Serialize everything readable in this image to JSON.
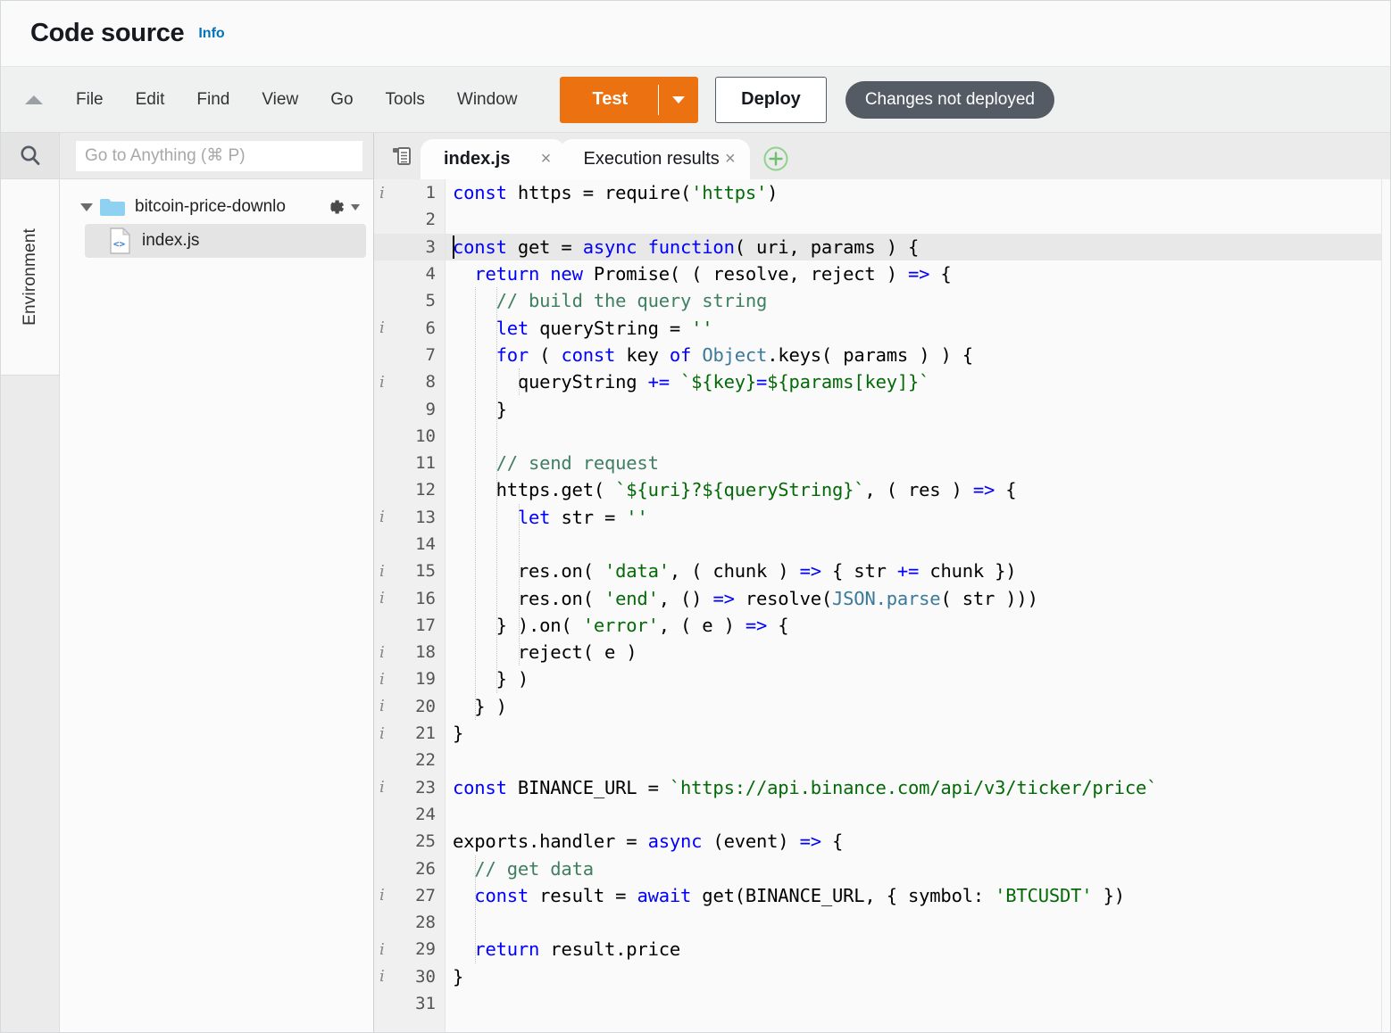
{
  "header": {
    "title": "Code source",
    "info_label": "Info"
  },
  "toolbar": {
    "collapse_icon": "caret-up-icon",
    "menus": [
      "File",
      "Edit",
      "Find",
      "View",
      "Go",
      "Tools",
      "Window"
    ],
    "test_label": "Test",
    "test_caret_icon": "caret-down-icon",
    "deploy_label": "Deploy",
    "status_badge": "Changes not deployed",
    "colors": {
      "test_button": "#ec7211",
      "status_badge": "#545b64",
      "info_link": "#0073bb"
    }
  },
  "rail": {
    "search_icon": "search-icon",
    "environment_label": "Environment"
  },
  "file_tree": {
    "search_placeholder": "Go to Anything (⌘ P)",
    "search_value": "",
    "folder": {
      "name": "bitcoin-price-downlo",
      "expanded": true,
      "caret_icon": "caret-down-icon",
      "folder_icon": "folder-icon",
      "gear_icon": "gear-icon",
      "gear_caret_icon": "caret-down-icon"
    },
    "files": [
      {
        "name": "index.js",
        "icon": "js-file-icon",
        "selected": true
      }
    ]
  },
  "editor": {
    "panel_icon": "document-list-icon",
    "tabs": [
      {
        "label": "index.js",
        "active": true,
        "close_icon": "close-icon"
      },
      {
        "label": "Execution results",
        "active": false,
        "close_icon": "close-icon",
        "clipped": true
      }
    ],
    "add_tab_icon": "plus-circle-icon",
    "cursor_line": 3,
    "info_marker_lines": [
      1,
      6,
      8,
      13,
      15,
      16,
      18,
      19,
      20,
      21,
      23,
      27,
      29,
      30
    ],
    "total_lines_visible": 31,
    "lines": [
      {
        "n": 1,
        "tokens": [
          [
            "kw",
            "const"
          ],
          [
            "txt",
            " https = "
          ],
          [
            "txt",
            "require("
          ],
          [
            "str",
            "'https'"
          ],
          [
            "txt",
            ")"
          ]
        ]
      },
      {
        "n": 2,
        "tokens": []
      },
      {
        "n": 3,
        "tokens": [
          [
            "kw",
            "const"
          ],
          [
            "txt",
            " get = "
          ],
          [
            "kw",
            "async function"
          ],
          [
            "txt",
            "( uri, params ) {"
          ]
        ]
      },
      {
        "n": 4,
        "tokens": [
          [
            "txt",
            "  "
          ],
          [
            "kw",
            "return new"
          ],
          [
            "txt",
            " Promise( ( resolve, reject ) "
          ],
          [
            "op",
            "=>"
          ],
          [
            "txt",
            " {"
          ]
        ]
      },
      {
        "n": 5,
        "tokens": [
          [
            "txt",
            "    "
          ],
          [
            "cmt",
            "// build the query string"
          ]
        ]
      },
      {
        "n": 6,
        "tokens": [
          [
            "txt",
            "    "
          ],
          [
            "kw",
            "let"
          ],
          [
            "txt",
            " queryString = "
          ],
          [
            "str",
            "''"
          ]
        ]
      },
      {
        "n": 7,
        "tokens": [
          [
            "txt",
            "    "
          ],
          [
            "kw",
            "for"
          ],
          [
            "txt",
            " ( "
          ],
          [
            "kw",
            "const"
          ],
          [
            "txt",
            " key "
          ],
          [
            "kw",
            "of"
          ],
          [
            "txt",
            " "
          ],
          [
            "fn",
            "Object"
          ],
          [
            "txt",
            ".keys( params ) ) {"
          ]
        ]
      },
      {
        "n": 8,
        "tokens": [
          [
            "txt",
            "      queryString "
          ],
          [
            "op",
            "+="
          ],
          [
            "txt",
            " "
          ],
          [
            "str",
            "`${key}"
          ],
          [
            "op",
            "="
          ],
          [
            "str",
            "${params[key]}`"
          ]
        ]
      },
      {
        "n": 9,
        "tokens": [
          [
            "txt",
            "    }"
          ]
        ]
      },
      {
        "n": 10,
        "tokens": []
      },
      {
        "n": 11,
        "tokens": [
          [
            "txt",
            "    "
          ],
          [
            "cmt",
            "// send request"
          ]
        ]
      },
      {
        "n": 12,
        "tokens": [
          [
            "txt",
            "    https.get( "
          ],
          [
            "str",
            "`${uri}?${queryString}`"
          ],
          [
            "txt",
            ", ( res ) "
          ],
          [
            "op",
            "=>"
          ],
          [
            "txt",
            " {"
          ]
        ]
      },
      {
        "n": 13,
        "tokens": [
          [
            "txt",
            "      "
          ],
          [
            "kw",
            "let"
          ],
          [
            "txt",
            " str = "
          ],
          [
            "str",
            "''"
          ]
        ]
      },
      {
        "n": 14,
        "tokens": []
      },
      {
        "n": 15,
        "tokens": [
          [
            "txt",
            "      res.on( "
          ],
          [
            "str",
            "'data'"
          ],
          [
            "txt",
            ", ( chunk ) "
          ],
          [
            "op",
            "=>"
          ],
          [
            "txt",
            " { str "
          ],
          [
            "op",
            "+="
          ],
          [
            "txt",
            " chunk })"
          ]
        ]
      },
      {
        "n": 16,
        "tokens": [
          [
            "txt",
            "      res.on( "
          ],
          [
            "str",
            "'end'"
          ],
          [
            "txt",
            ", () "
          ],
          [
            "op",
            "=>"
          ],
          [
            "txt",
            " resolve("
          ],
          [
            "fn",
            "JSON.parse"
          ],
          [
            "txt",
            "( str )))"
          ]
        ]
      },
      {
        "n": 17,
        "tokens": [
          [
            "txt",
            "    } ).on( "
          ],
          [
            "str",
            "'error'"
          ],
          [
            "txt",
            ", ( e ) "
          ],
          [
            "op",
            "=>"
          ],
          [
            "txt",
            " {"
          ]
        ]
      },
      {
        "n": 18,
        "tokens": [
          [
            "txt",
            "      reject( e )"
          ]
        ]
      },
      {
        "n": 19,
        "tokens": [
          [
            "txt",
            "    } )"
          ]
        ]
      },
      {
        "n": 20,
        "tokens": [
          [
            "txt",
            "  } )"
          ]
        ]
      },
      {
        "n": 21,
        "tokens": [
          [
            "txt",
            "}"
          ]
        ]
      },
      {
        "n": 22,
        "tokens": []
      },
      {
        "n": 23,
        "tokens": [
          [
            "kw",
            "const"
          ],
          [
            "txt",
            " BINANCE_URL = "
          ],
          [
            "str",
            "`https://api.binance.com/api/v3/ticker/price`"
          ]
        ]
      },
      {
        "n": 24,
        "tokens": []
      },
      {
        "n": 25,
        "tokens": [
          [
            "txt",
            "exports.handler = "
          ],
          [
            "kw",
            "async"
          ],
          [
            "txt",
            " (event) "
          ],
          [
            "op",
            "=>"
          ],
          [
            "txt",
            " {"
          ]
        ]
      },
      {
        "n": 26,
        "tokens": [
          [
            "txt",
            "  "
          ],
          [
            "cmt",
            "// get data"
          ]
        ]
      },
      {
        "n": 27,
        "tokens": [
          [
            "txt",
            "  "
          ],
          [
            "kw",
            "const"
          ],
          [
            "txt",
            " result = "
          ],
          [
            "kw",
            "await"
          ],
          [
            "txt",
            " get(BINANCE_URL, { symbol: "
          ],
          [
            "str",
            "'BTCUSDT'"
          ],
          [
            "txt",
            " })"
          ]
        ]
      },
      {
        "n": 28,
        "tokens": []
      },
      {
        "n": 29,
        "tokens": [
          [
            "txt",
            "  "
          ],
          [
            "kw",
            "return"
          ],
          [
            "txt",
            " result.price"
          ]
        ]
      },
      {
        "n": 30,
        "tokens": [
          [
            "txt",
            "}"
          ]
        ]
      },
      {
        "n": 31,
        "tokens": []
      }
    ],
    "syntax_colors": {
      "keyword": "#0000ff",
      "string": "#036a07",
      "comment": "#3f7f5f",
      "function": "#3a7999",
      "text": "#000000",
      "cursor_line_bg": "#e8e8e8"
    }
  }
}
